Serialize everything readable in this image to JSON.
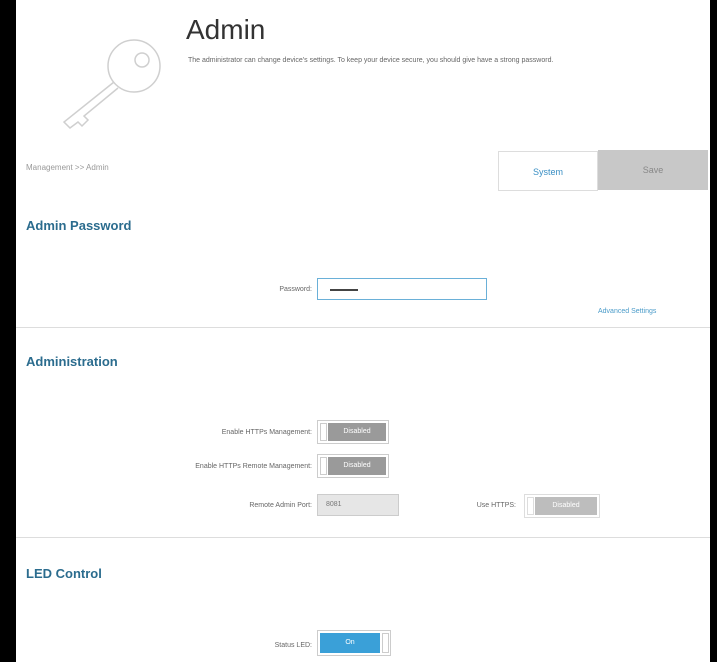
{
  "header": {
    "title": "Admin",
    "description": "The administrator can change device's settings. To keep your device secure, you should give have a strong password."
  },
  "breadcrumb": "Management >> Admin",
  "toolbar": {
    "system_label": "System",
    "save_label": "Save"
  },
  "admin_password": {
    "heading": "Admin Password",
    "password_label": "Password:",
    "password_value": "",
    "advanced_link": "Advanced Settings"
  },
  "administration": {
    "heading": "Administration",
    "https_mgmt_label": "Enable HTTPs Management:",
    "https_mgmt_state": "Disabled",
    "https_remote_label": "Enable HTTPs Remote Management:",
    "https_remote_state": "Disabled",
    "remote_port_label": "Remote Admin Port:",
    "remote_port_value": "8081",
    "use_https_label": "Use HTTPS:",
    "use_https_state": "Disabled"
  },
  "led": {
    "heading": "LED Control",
    "status_led_label": "Status LED:",
    "status_led_state": "On"
  },
  "colors": {
    "accent": "#2b6c8e",
    "link": "#4a9bc9",
    "on": "#3aa0d8",
    "disabled": "#9a9a9a",
    "save_bg": "#c8c8c8"
  }
}
